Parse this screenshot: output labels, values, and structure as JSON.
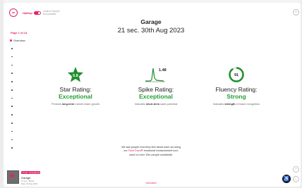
{
  "header": {
    "logo_text": "IIIII",
    "toggle_label": "Halftop",
    "toggle_hint": "Caution! Sample. Not saveable",
    "close_glyph": "×"
  },
  "report": {
    "title": "Garage",
    "subtitle": "21 sec. 30th Aug 2023"
  },
  "nav": {
    "page_indicator": "Page 1 of 14",
    "overview_label": "Overview",
    "item_count": 13
  },
  "metrics": [
    {
      "name": "Star Rating:",
      "rating": "Exceptional",
      "icon_value": "5.8",
      "desc_prefix": "Predicts ",
      "desc_bold": "long-term",
      "desc_suffix": " market share growth",
      "color": "#22a033"
    },
    {
      "name": "Spike Rating:",
      "rating": "Exceptional",
      "icon_value": "1.48",
      "desc_prefix": "Indicates ",
      "desc_bold": "short-term",
      "desc_suffix": " sales potential",
      "color": "#22a033"
    },
    {
      "name": "Fluency Rating:",
      "rating": "Strong",
      "icon_value": "91",
      "desc_prefix": "Indicates ",
      "desc_bold": "strength",
      "desc_suffix": " of brand recognition",
      "color": "#22a033"
    }
  ],
  "footer": {
    "line1": "We ask people how they feel about each ad using",
    "line2_prefix": "our ",
    "line2_highlight": "FaceTrace",
    "line2_suffix": "® emotional measurement tool,",
    "line3": "used on over 10m people worldwide."
  },
  "ad_card": {
    "badge1": "TV Ad",
    "badge2": "Exceptional",
    "title": "Garage",
    "meta1": "21 sec · Brand",
    "meta2": "Date: 30 Aug 2023"
  },
  "bottom_label": "Unlocked",
  "accessibility_glyph": "♿",
  "scroll_up_glyph": "⌃",
  "scroll_down_glyph": "⌄",
  "colors": {
    "brand": "#e2246b",
    "good": "#22a033"
  }
}
